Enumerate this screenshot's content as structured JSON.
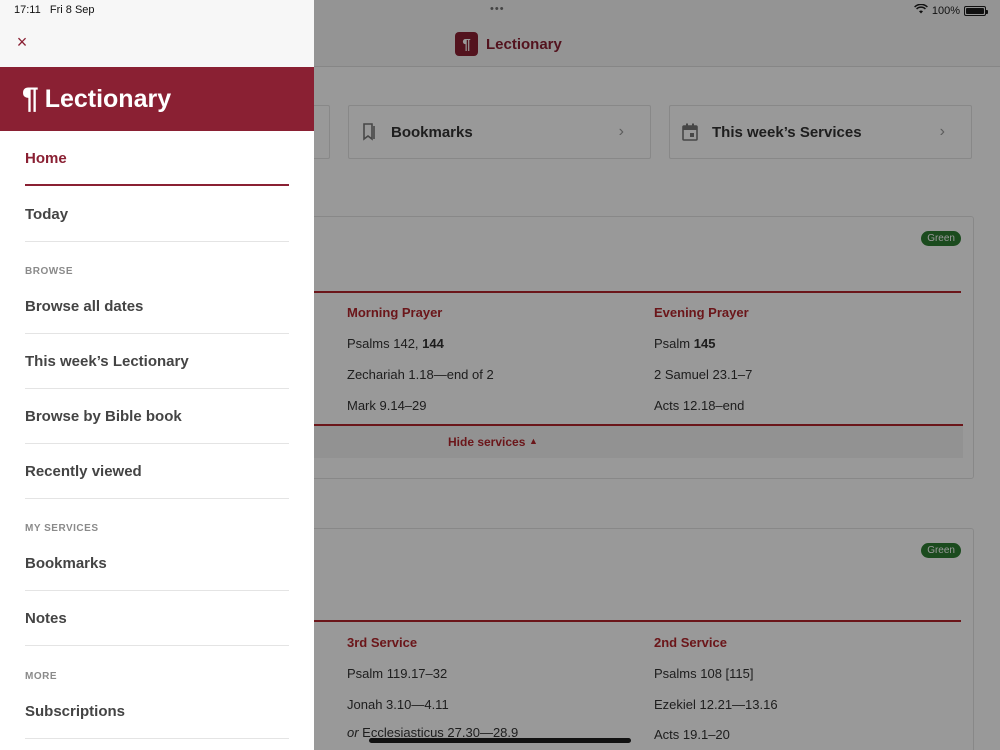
{
  "status": {
    "time": "17:11",
    "date": "Fri 8 Sep",
    "multitask_dots": "•••",
    "battery": "100%",
    "battery_level": 1.0
  },
  "app": {
    "title": "Lectionary",
    "badge_glyph": "¶"
  },
  "quick_links": [
    {
      "label": "Bookmarks",
      "icon": "bookmark-icon"
    },
    {
      "label": "This week’s Services",
      "icon": "calendar-icon"
    }
  ],
  "card1": {
    "badge": "Green",
    "columns": [
      {
        "title": "Morning Prayer",
        "readings": [
          {
            "text": "Psalms 142, ",
            "bold": "144"
          },
          {
            "text": "Zechariah 1.18—end of 2",
            "bold": ""
          },
          {
            "text": "Mark 9.14–29",
            "bold": ""
          }
        ]
      },
      {
        "title": "Evening Prayer",
        "readings": [
          {
            "text": "Psalm ",
            "bold": "145"
          },
          {
            "text": "2 Samuel 23.1–7",
            "bold": ""
          },
          {
            "text": "Acts 12.18–end",
            "bold": ""
          }
        ]
      }
    ],
    "hide_label": "Hide services"
  },
  "card2": {
    "badge": "Green",
    "columns": [
      {
        "title": "3rd Service",
        "readings": [
          {
            "text": "Psalm 119.17–32"
          },
          {
            "text": "Jonah 3.10—4.11"
          },
          {
            "prefix": "or ",
            "text": "Ecclesiasticus 27.30—28.9"
          }
        ]
      },
      {
        "title": "2nd Service",
        "readings": [
          {
            "text": "Psalms 108 [115]"
          },
          {
            "text": "Ezekiel 12.21—13.16"
          },
          {
            "text": "Acts 19.1–20"
          }
        ]
      }
    ]
  },
  "drawer": {
    "close_glyph": "×",
    "title": "Lectionary",
    "logo_glyph": "¶",
    "items": {
      "home": "Home",
      "today": "Today",
      "browse_label": "BROWSE",
      "browse_all": "Browse all dates",
      "this_week": "This week’s Lectionary",
      "bible_book": "Browse by Bible book",
      "recent": "Recently viewed",
      "my_services_label": "MY SERVICES",
      "bookmarks": "Bookmarks",
      "notes": "Notes",
      "more_label": "MORE",
      "subscriptions": "Subscriptions"
    }
  },
  "colors": {
    "brand": "#8a2033",
    "accent_red": "#b3262c",
    "green": "#2e7d32"
  }
}
